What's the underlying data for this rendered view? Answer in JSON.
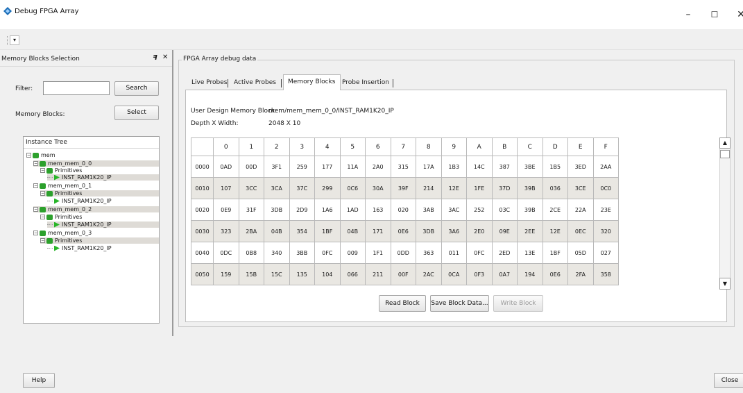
{
  "window": {
    "title": "Debug FPGA Array",
    "minimize_glyph": "–",
    "maximize_glyph": "☐",
    "close_glyph": "✕"
  },
  "toolbar": {
    "menu_glyph": "▾"
  },
  "left_panel": {
    "title": "Memory Blocks Selection",
    "float_glyph": "ꟻ",
    "close_glyph": "✕",
    "filter_label": "Filter:",
    "filter_value": "",
    "search_label": "Search",
    "memory_blocks_label": "Memory Blocks:",
    "select_label": "Select",
    "tree": {
      "header": "Instance Tree",
      "nodes": [
        {
          "label": "mem"
        },
        {
          "label": "mem_mem_0_0"
        },
        {
          "label": "Primitives"
        },
        {
          "label": "INST_RAM1K20_IP"
        },
        {
          "label": "mem_mem_0_1"
        },
        {
          "label": "Primitives"
        },
        {
          "label": "INST_RAM1K20_IP"
        },
        {
          "label": "mem_mem_0_2"
        },
        {
          "label": "Primitives"
        },
        {
          "label": "INST_RAM1K20_IP"
        },
        {
          "label": "mem_mem_0_3"
        },
        {
          "label": "Primitives"
        },
        {
          "label": "INST_RAM1K20_IP"
        }
      ]
    }
  },
  "main": {
    "group_title": "FPGA Array debug data",
    "tabs": [
      {
        "label": "Live Probes"
      },
      {
        "label": "Active Probes"
      },
      {
        "label": "Memory Blocks"
      },
      {
        "label": "Probe Insertion"
      }
    ],
    "user_design_memory_block_label": "User Design Memory Block:",
    "user_design_memory_block_value": "mem/mem_mem_0_0/INST_RAM1K20_IP",
    "depth_width_label": "Depth X Width:",
    "depth_width_value": "2048 X 10",
    "table": {
      "columns": [
        "0",
        "1",
        "2",
        "3",
        "4",
        "5",
        "6",
        "7",
        "8",
        "9",
        "A",
        "B",
        "C",
        "D",
        "E",
        "F"
      ],
      "rows": [
        {
          "addr": "0000",
          "cells": [
            "0AD",
            "00D",
            "3F1",
            "259",
            "177",
            "11A",
            "2A0",
            "315",
            "17A",
            "1B3",
            "14C",
            "387",
            "3BE",
            "1B5",
            "3ED",
            "2AA"
          ]
        },
        {
          "addr": "0010",
          "cells": [
            "107",
            "3CC",
            "3CA",
            "37C",
            "299",
            "0C6",
            "30A",
            "39F",
            "214",
            "12E",
            "1FE",
            "37D",
            "39B",
            "036",
            "3CE",
            "0C0"
          ]
        },
        {
          "addr": "0020",
          "cells": [
            "0E9",
            "31F",
            "3DB",
            "2D9",
            "1A6",
            "1AD",
            "163",
            "020",
            "3AB",
            "3AC",
            "252",
            "03C",
            "39B",
            "2CE",
            "22A",
            "23E"
          ]
        },
        {
          "addr": "0030",
          "cells": [
            "323",
            "2BA",
            "04B",
            "354",
            "1BF",
            "04B",
            "171",
            "0E6",
            "3DB",
            "3A6",
            "2E0",
            "09E",
            "2EE",
            "12E",
            "0EC",
            "320"
          ]
        },
        {
          "addr": "0040",
          "cells": [
            "0DC",
            "0B8",
            "340",
            "3BB",
            "0FC",
            "009",
            "1F1",
            "0DD",
            "363",
            "011",
            "0FC",
            "2ED",
            "13E",
            "1BF",
            "05D",
            "027"
          ]
        },
        {
          "addr": "0050",
          "cells": [
            "159",
            "15B",
            "15C",
            "135",
            "104",
            "066",
            "211",
            "00F",
            "2AC",
            "0CA",
            "0F3",
            "0A7",
            "194",
            "0E6",
            "2FA",
            "358"
          ]
        }
      ]
    },
    "scroll_up_glyph": "▲",
    "scroll_down_glyph": "▼",
    "read_block_label": "Read Block",
    "save_block_label": "Save Block Data...",
    "write_block_label": "Write Block"
  },
  "footer": {
    "help_label": "Help",
    "close_label": "Close"
  },
  "colors": {
    "accent_icon": "#2ca02c",
    "row_shade": "#e9e7e2",
    "background": "#f0f0f0"
  },
  "icons": [
    "app-icon",
    "toolbar-menu-icon",
    "float-icon",
    "close-icon",
    "tree-expand-icon",
    "tree-node-icon",
    "leaf-icon"
  ]
}
